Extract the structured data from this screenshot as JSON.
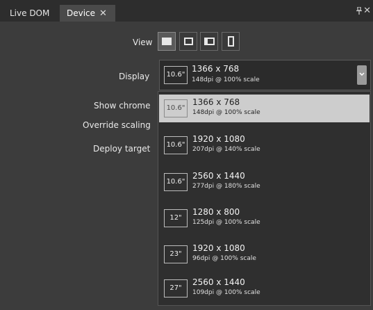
{
  "tabs": {
    "live_dom": "Live DOM",
    "device": "Device",
    "device_close": "✕",
    "pin": "📌",
    "pane_close": "✕"
  },
  "labels": {
    "view": "View",
    "display": "Display",
    "show_chrome": "Show chrome",
    "override_scaling": "Override scaling",
    "deploy_target": "Deploy target"
  },
  "view_buttons": [
    {
      "icon": "landscape-full-icon",
      "selected": true
    },
    {
      "icon": "landscape-small-icon",
      "selected": false
    },
    {
      "icon": "landscape-snapped-icon",
      "selected": false
    },
    {
      "icon": "portrait-icon",
      "selected": false
    }
  ],
  "display": {
    "size": "10.6\"",
    "resolution": "1366 x 768",
    "dpi": "148dpi @ 100% scale"
  },
  "options": [
    {
      "size": "10.6\"",
      "resolution": "1366 x 768",
      "dpi": "148dpi @ 100% scale"
    },
    {
      "size": "10.6\"",
      "resolution": "1920 x 1080",
      "dpi": "207dpi @ 140% scale"
    },
    {
      "size": "10.6\"",
      "resolution": "2560 x 1440",
      "dpi": "277dpi @ 180% scale"
    },
    {
      "size": "12\"",
      "resolution": "1280 x 800",
      "dpi": "125dpi @ 100% scale"
    },
    {
      "size": "23\"",
      "resolution": "1920 x 1080",
      "dpi": "96dpi @ 100% scale"
    },
    {
      "size": "27\"",
      "resolution": "2560 x 1440",
      "dpi": "109dpi @ 100% scale"
    }
  ],
  "selected_option_index": 0,
  "colors": {
    "panel_bg": "#3c3c3c",
    "tab_active": "#4a4a4a",
    "dropdown_bg": "#2f2f2f",
    "selected_item_bg": "#cdcdcd"
  }
}
